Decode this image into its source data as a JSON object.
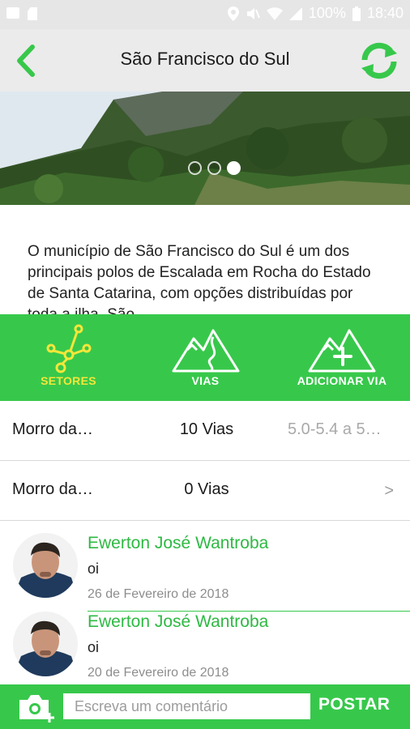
{
  "status_bar": {
    "battery": "100%",
    "time": "18:40",
    "icons": [
      "image-icon",
      "sd-card-icon",
      "location-icon",
      "mute-icon",
      "wifi-icon",
      "signal-icon",
      "battery-icon"
    ]
  },
  "header": {
    "title": "São Francisco do Sul",
    "back_icon": "back-arrow-icon",
    "refresh_icon": "refresh-icon"
  },
  "carousel": {
    "total": 3,
    "active_index": 3
  },
  "description": "O município de São Francisco do Sul é um dos principais polos de Escalada em Rocha do Estado de Santa Catarina, com opções distribuídas por toda a ilha. São",
  "tabs": [
    {
      "label": "SETORES",
      "icon": "sectors-icon",
      "active": true
    },
    {
      "label": "VIAS",
      "icon": "routes-mountain-icon",
      "active": false
    },
    {
      "label": "ADICIONAR VIA",
      "icon": "add-route-mountain-icon",
      "active": false
    }
  ],
  "sectors": [
    {
      "name": "Morro da…",
      "count": "10 Vias",
      "grade": "5.0-5.4 a 5…",
      "chevron": ""
    },
    {
      "name": "Morro da…",
      "count": "0 Vias",
      "grade": "",
      "chevron": ">"
    }
  ],
  "comments": [
    {
      "author": "Ewerton José Wantroba",
      "text": "oi",
      "date": "26 de Fevereiro de 2018"
    },
    {
      "author": "Ewerton José Wantroba",
      "text": "oi",
      "date": "20 de Fevereiro de 2018"
    }
  ],
  "composer": {
    "placeholder": "Escreva um comentário",
    "post_label": "POSTAR",
    "camera_icon": "camera-add-icon"
  },
  "colors": {
    "accent_green": "#37c84b",
    "active_tab_yellow": "#f5e63a",
    "author_green": "#2eb943"
  }
}
